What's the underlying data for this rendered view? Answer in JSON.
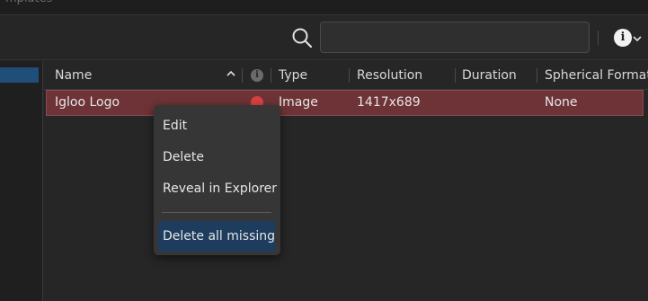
{
  "window": {
    "partial_title": "mplates"
  },
  "toolbar": {
    "search_value": "",
    "search_icon": "search-icon",
    "info_icon": "info-icon"
  },
  "table": {
    "columns": [
      "Name",
      "Type",
      "Resolution",
      "Duration",
      "Spherical Format"
    ],
    "rows": [
      {
        "name": "Igloo Logo",
        "status": "missing",
        "type": "Image",
        "resolution": "1417x689",
        "duration": "",
        "spherical_format": "None"
      }
    ]
  },
  "context_menu": {
    "items": [
      "Edit",
      "Delete",
      "Reveal in Explorer"
    ],
    "highlighted_item": "Delete all missing"
  },
  "colors": {
    "background": "#262626",
    "row_error": "#6e3336",
    "menu_highlight": "#1d3c5e",
    "selection_accent": "#1f4e79",
    "missing_icon": "#d94040"
  }
}
